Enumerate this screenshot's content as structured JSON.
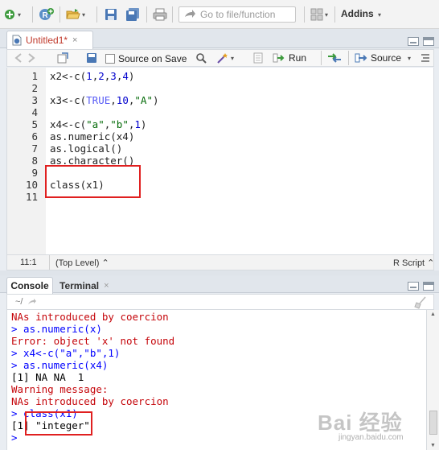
{
  "toolbar": {
    "goto_placeholder": "Go to file/function",
    "addins_label": "Addins",
    "dropdown_glyph": "▾"
  },
  "editor": {
    "tab_name": "Untitled1*",
    "tab_close": "×",
    "source_on_save_label": "Source on Save",
    "run_label": "Run",
    "source_label": "Source",
    "lines": [
      {
        "n": "1",
        "code": "x2<-c(1,2,3,4)"
      },
      {
        "n": "2",
        "code": ""
      },
      {
        "n": "3",
        "code": "x3<-c(TRUE,10,\"A\")"
      },
      {
        "n": "4",
        "code": ""
      },
      {
        "n": "5",
        "code": "x4<-c(\"a\",\"b\",1)"
      },
      {
        "n": "6",
        "code": "as.numeric(x4)"
      },
      {
        "n": "7",
        "code": "as.logical()"
      },
      {
        "n": "8",
        "code": "as.character()"
      },
      {
        "n": "9",
        "code": ""
      },
      {
        "n": "10",
        "code": "class(x1)"
      },
      {
        "n": "11",
        "code": ""
      }
    ],
    "status_position": "11:1",
    "status_scope": "(Top Level) ⌃",
    "status_filetype": "R Script ⌃"
  },
  "console": {
    "tab_console": "Console",
    "tab_terminal": "Terminal",
    "tab_close": "×",
    "path": "~/",
    "lines": [
      {
        "text": "NAs introduced by coercion",
        "kind": "err"
      },
      {
        "text": "> as.numeric(x)",
        "kind": "cmd"
      },
      {
        "text": "Error: object 'x' not found",
        "kind": "err"
      },
      {
        "text": "> x4<-c(\"a\",\"b\",1)",
        "kind": "cmd"
      },
      {
        "text": "> as.numeric(x4)",
        "kind": "cmd"
      },
      {
        "text": "[1] NA NA  1",
        "kind": "out"
      },
      {
        "text": "Warning message:",
        "kind": "err"
      },
      {
        "text": "NAs introduced by coercion",
        "kind": "err"
      },
      {
        "text": "> class(x1)",
        "kind": "cmd"
      },
      {
        "text": "[1] \"integer\"",
        "kind": "out"
      },
      {
        "text": ">",
        "kind": "cmd"
      }
    ]
  },
  "watermark": {
    "text": "Bai 经验",
    "url": "jingyan.baidu.com"
  },
  "colors": {
    "highlight": "#e02020",
    "console_error": "#c5060b",
    "console_command": "#0000ff",
    "tab_modified": "#c0392b"
  }
}
